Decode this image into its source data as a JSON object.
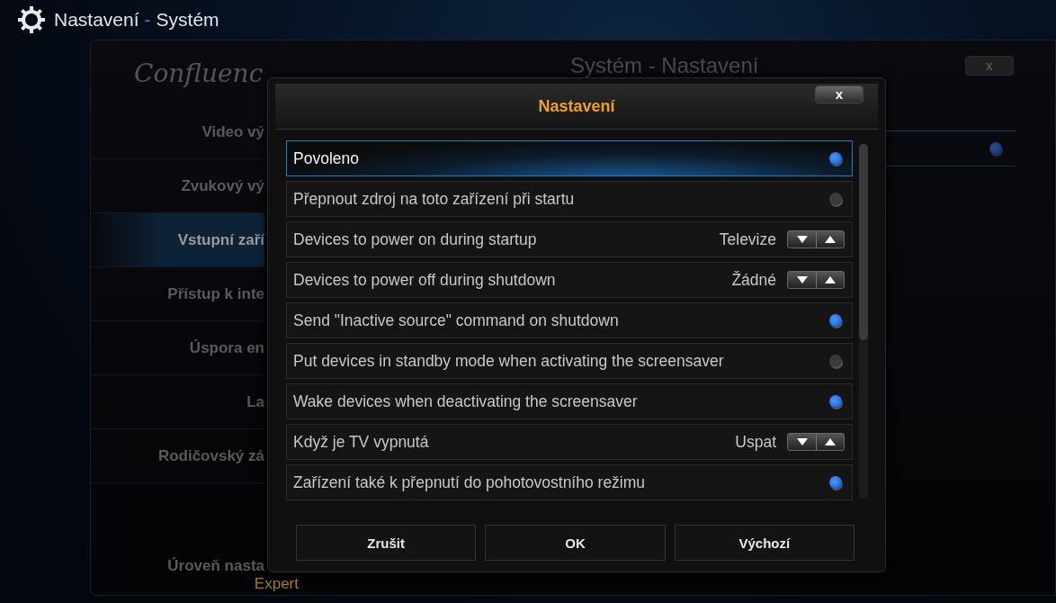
{
  "header": {
    "title": "Nastavení",
    "separator": "-",
    "subtitle": "Systém"
  },
  "background_panel": {
    "logo": "Confluenc",
    "title": "Systém - Nastavení",
    "close": "x",
    "menu": [
      {
        "label": "Video vý",
        "selected": false
      },
      {
        "label": "Zvukový vý",
        "selected": false
      },
      {
        "label": "Vstupní zaří",
        "selected": true
      },
      {
        "label": "Přístup k inte",
        "selected": false
      },
      {
        "label": "Úspora en",
        "selected": false
      },
      {
        "label": "La",
        "selected": false
      },
      {
        "label": "Rodičovský zá",
        "selected": false
      }
    ],
    "level_label": "Úroveň nasta",
    "level_value": "Expert",
    "row_toggle_on": true
  },
  "dialog": {
    "title": "Nastavení",
    "close": "x",
    "rows": [
      {
        "kind": "toggle",
        "label": "Povoleno",
        "on": true,
        "selected": true
      },
      {
        "kind": "toggle",
        "label": "Přepnout zdroj na toto zařízení při startu",
        "on": false,
        "selected": false
      },
      {
        "kind": "spinner",
        "label": "Devices to power on during startup",
        "value": "Televize",
        "selected": false
      },
      {
        "kind": "spinner",
        "label": "Devices to power off during shutdown",
        "value": "Žádné",
        "selected": false
      },
      {
        "kind": "toggle",
        "label": "Send \"Inactive source\" command on shutdown",
        "on": true,
        "selected": false
      },
      {
        "kind": "toggle",
        "label": "Put devices in standby mode when activating the screensaver",
        "on": false,
        "selected": false
      },
      {
        "kind": "toggle",
        "label": "Wake devices when deactivating the screensaver",
        "on": true,
        "selected": false
      },
      {
        "kind": "spinner",
        "label": "Když je TV vypnutá",
        "value": "Uspat",
        "selected": false
      },
      {
        "kind": "toggle",
        "label": "Zařízení také k přepnutí do pohotovostního režimu",
        "on": true,
        "selected": false
      }
    ],
    "buttons": [
      "Zrušit",
      "OK",
      "Výchozí"
    ]
  }
}
